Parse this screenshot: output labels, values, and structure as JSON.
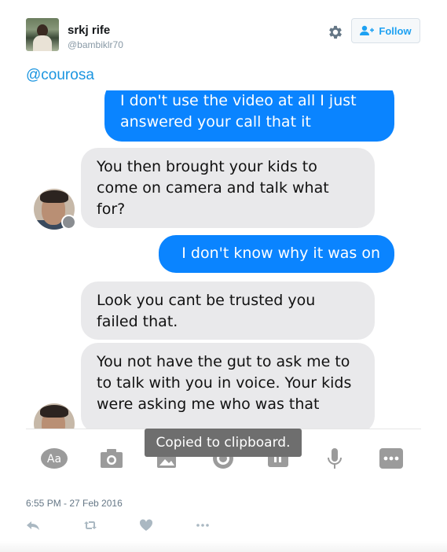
{
  "author": {
    "name": "srkj rife",
    "handle": "@bambiklr70"
  },
  "follow_label": "Follow",
  "tweet": {
    "mention": "@courosa",
    "timestamp": "6:55 PM - 27 Feb 2016"
  },
  "conversation": {
    "messages": [
      {
        "direction": "outgoing",
        "text": "I don't use the video at all I just answered your call that it"
      },
      {
        "direction": "incoming",
        "text": "You then brought your kids to come on camera and talk what for?"
      },
      {
        "direction": "outgoing",
        "text": "I don't know why it was on"
      },
      {
        "direction": "incoming",
        "text": "Look you cant be trusted you failed that."
      },
      {
        "direction": "incoming",
        "text": "You not have the gut to ask me to to talk with you in voice. Your kids were asking me who was that"
      }
    ],
    "toast": "Copied to clipboard.",
    "composer_aa": "Aa"
  },
  "colors": {
    "tweet_link": "#1b95e0",
    "outgoing_bubble": "#0a84ff",
    "incoming_bubble": "#e9e9eb",
    "follow_text": "#1da1f2"
  },
  "icons": {
    "header": [
      "gear-icon",
      "follow-person-plus-icon"
    ],
    "composer": [
      "aa-text-icon",
      "camera-icon",
      "image-icon",
      "sticker-icon",
      "gif-icon",
      "microphone-icon",
      "more-icon"
    ],
    "tweet_actions": [
      "reply-icon",
      "retweet-icon",
      "like-icon",
      "more-icon"
    ]
  }
}
